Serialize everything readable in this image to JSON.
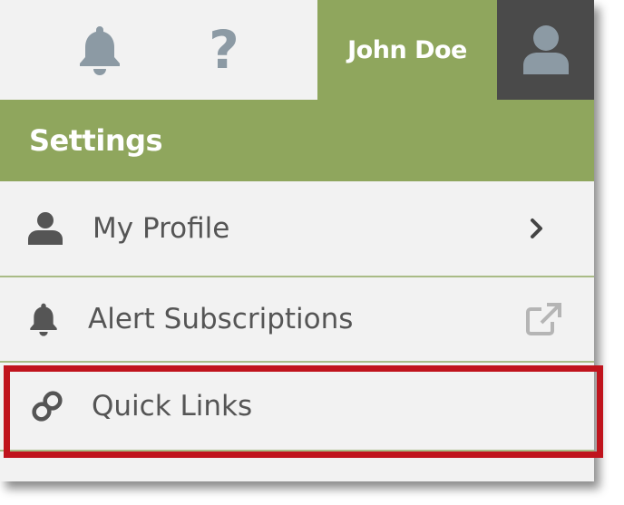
{
  "header": {
    "user_name": "John Doe",
    "help_glyph": "?",
    "icons": [
      "bell-icon",
      "help-icon",
      "user-avatar-icon"
    ]
  },
  "menu": {
    "title": "Settings",
    "items": [
      {
        "label": "My Profile",
        "icon": "user-icon",
        "trailing_icon": "chevron-right-icon"
      },
      {
        "label": "Alert Subscriptions",
        "icon": "bell-icon",
        "trailing_icon": "external-link-icon"
      },
      {
        "label": "Quick Links",
        "icon": "link-icon",
        "highlighted": true
      }
    ]
  },
  "colors": {
    "accent_green": "#8fa65d",
    "avatar_bg": "#4a4a4a",
    "icon_gray": "#8c9aa4",
    "highlight_red": "#c0141d",
    "text_gray": "#555555"
  }
}
